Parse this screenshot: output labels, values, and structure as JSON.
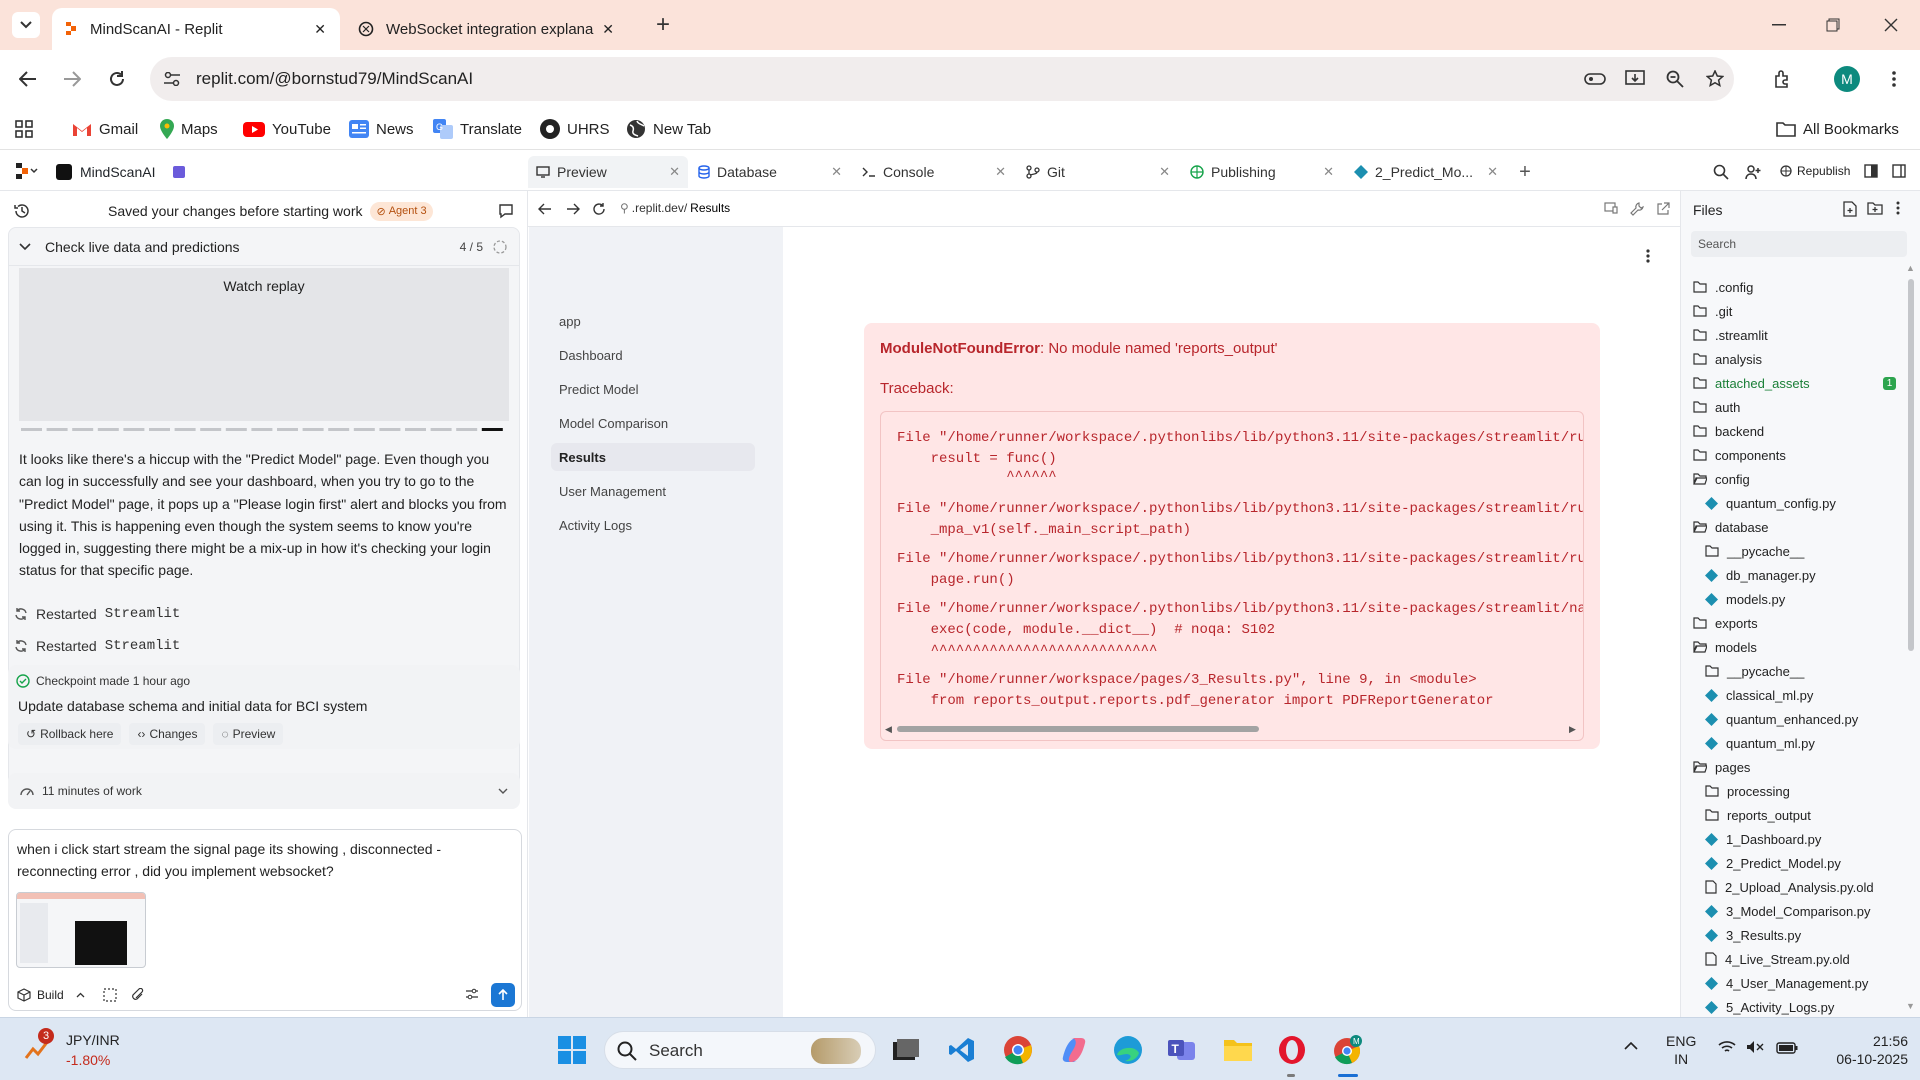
{
  "browser": {
    "tabs": [
      {
        "title": "MindScanAI - Replit",
        "close": "✕"
      },
      {
        "title": "WebSocket integration explana",
        "close": "✕"
      }
    ],
    "url": "replit.com/@bornstud79/MindScanAI",
    "profile_letter": "M",
    "bookmarks": [
      "Gmail",
      "Maps",
      "YouTube",
      "News",
      "Translate",
      "UHRS",
      "New Tab"
    ],
    "all_bookmarks": "All Bookmarks"
  },
  "replit": {
    "project_name": "MindScanAI",
    "tabs": [
      {
        "label": "Preview"
      },
      {
        "label": "Database"
      },
      {
        "label": "Console"
      },
      {
        "label": "Git"
      },
      {
        "label": "Publishing"
      },
      {
        "label": "2_Predict_Mo..."
      }
    ],
    "republish": "Republish"
  },
  "agent": {
    "saved_message": "Saved your changes before starting work",
    "agent_badge": "Agent 3",
    "task_title": "Check live data and predictions",
    "task_progress": "4 / 5",
    "watch_replay": "Watch replay",
    "message": "It looks like there's a hiccup with the \"Predict Model\" page. Even though you can log in successfully and see your dashboard, when you try to go to the \"Predict Model\" page, it pops up a \"Please login first\" alert and blocks you from using it. This is happening even though the system seems to know you're logged in, suggesting there might be a mix-up in how it's checking your login status for that specific page.",
    "restarted_prefix": "Restarted",
    "restarted_app": "Streamlit",
    "checkpoint": "Checkpoint made 1 hour ago",
    "checkpoint_desc": "Update database schema and initial data for BCI system",
    "rollback": "Rollback here",
    "changes": "Changes",
    "preview": "Preview",
    "work_time": "11 minutes of work",
    "input_text": "when i click start stream the signal page its showing , disconnected - reconnecting error , did you implement websocket?",
    "build": "Build"
  },
  "preview": {
    "url_prefix": ".replit.dev/",
    "url_path": "Results",
    "nav": [
      "app",
      "Dashboard",
      "Predict Model",
      "Model Comparison",
      "Results",
      "User Management",
      "Activity Logs"
    ],
    "selected_nav": "Results",
    "error_type": "ModuleNotFoundError",
    "error_msg": ": No module named 'reports_output'",
    "traceback_label": "Traceback:",
    "traceback": [
      "File \"/home/runner/workspace/.pythonlibs/lib/python3.11/site-packages/streamlit/ru",
      "    result = func()",
      "             ^^^^^^",
      "File \"/home/runner/workspace/.pythonlibs/lib/python3.11/site-packages/streamlit/ru",
      "    _mpa_v1(self._main_script_path)",
      "File \"/home/runner/workspace/.pythonlibs/lib/python3.11/site-packages/streamlit/ru",
      "    page.run()",
      "File \"/home/runner/workspace/.pythonlibs/lib/python3.11/site-packages/streamlit/na",
      "    exec(code, module.__dict__)  # noqa: S102",
      "    ^^^^^^^^^^^^^^^^^^^^^^^^^^^",
      "File \"/home/runner/workspace/pages/3_Results.py\", line 9, in <module>",
      "    from reports_output.reports.pdf_generator import PDFReportGenerator"
    ]
  },
  "files": {
    "title": "Files",
    "search_placeholder": "Search",
    "items": [
      {
        "name": ".config",
        "kind": "folder",
        "depth": 0
      },
      {
        "name": ".git",
        "kind": "folder",
        "depth": 0
      },
      {
        "name": ".streamlit",
        "kind": "folder",
        "depth": 0
      },
      {
        "name": "analysis",
        "kind": "folder",
        "depth": 0
      },
      {
        "name": "attached_assets",
        "kind": "folder",
        "depth": 0,
        "badge": "1"
      },
      {
        "name": "auth",
        "kind": "folder",
        "depth": 0
      },
      {
        "name": "backend",
        "kind": "folder",
        "depth": 0
      },
      {
        "name": "components",
        "kind": "folder",
        "depth": 0
      },
      {
        "name": "config",
        "kind": "folder-open",
        "depth": 0
      },
      {
        "name": "quantum_config.py",
        "kind": "py",
        "depth": 1
      },
      {
        "name": "database",
        "kind": "folder-open",
        "depth": 0
      },
      {
        "name": "__pycache__",
        "kind": "folder",
        "depth": 1
      },
      {
        "name": "db_manager.py",
        "kind": "py",
        "depth": 1
      },
      {
        "name": "models.py",
        "kind": "py",
        "depth": 1
      },
      {
        "name": "exports",
        "kind": "folder",
        "depth": 0
      },
      {
        "name": "models",
        "kind": "folder-open",
        "depth": 0
      },
      {
        "name": "__pycache__",
        "kind": "folder",
        "depth": 1
      },
      {
        "name": "classical_ml.py",
        "kind": "py",
        "depth": 1
      },
      {
        "name": "quantum_enhanced.py",
        "kind": "py",
        "depth": 1
      },
      {
        "name": "quantum_ml.py",
        "kind": "py",
        "depth": 1
      },
      {
        "name": "pages",
        "kind": "folder-open",
        "depth": 0
      },
      {
        "name": "processing",
        "kind": "folder",
        "depth": 1
      },
      {
        "name": "reports_output",
        "kind": "folder",
        "depth": 1
      },
      {
        "name": "1_Dashboard.py",
        "kind": "py",
        "depth": 1
      },
      {
        "name": "2_Predict_Model.py",
        "kind": "py",
        "depth": 1
      },
      {
        "name": "2_Upload_Analysis.py.old",
        "kind": "file",
        "depth": 1
      },
      {
        "name": "3_Model_Comparison.py",
        "kind": "py",
        "depth": 1
      },
      {
        "name": "3_Results.py",
        "kind": "py",
        "depth": 1
      },
      {
        "name": "4_Live_Stream.py.old",
        "kind": "file",
        "depth": 1
      },
      {
        "name": "4_User_Management.py",
        "kind": "py",
        "depth": 1
      },
      {
        "name": "5_Activity_Logs.py",
        "kind": "py",
        "depth": 1
      }
    ]
  },
  "taskbar": {
    "weather_badge": "3",
    "ticker": "JPY/INR",
    "ticker_change": "-1.80%",
    "search": "Search",
    "lang1": "ENG",
    "lang2": "IN",
    "time": "21:56",
    "date": "06-10-2025"
  }
}
